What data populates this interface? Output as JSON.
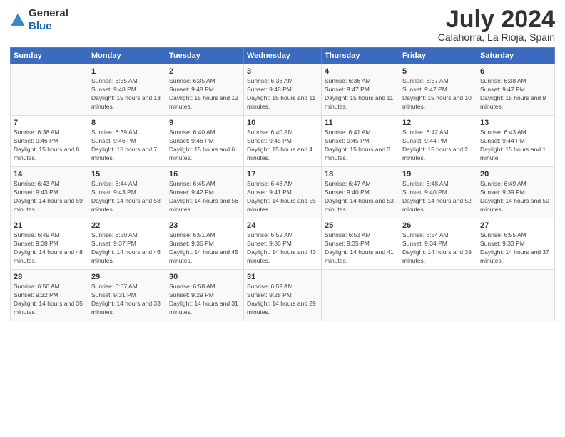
{
  "logo": {
    "general": "General",
    "blue": "Blue"
  },
  "title": "July 2024",
  "location": "Calahorra, La Rioja, Spain",
  "days_header": [
    "Sunday",
    "Monday",
    "Tuesday",
    "Wednesday",
    "Thursday",
    "Friday",
    "Saturday"
  ],
  "weeks": [
    [
      {
        "day": "",
        "sunrise": "",
        "sunset": "",
        "daylight": ""
      },
      {
        "day": "1",
        "sunrise": "Sunrise: 6:35 AM",
        "sunset": "Sunset: 9:48 PM",
        "daylight": "Daylight: 15 hours and 13 minutes."
      },
      {
        "day": "2",
        "sunrise": "Sunrise: 6:35 AM",
        "sunset": "Sunset: 9:48 PM",
        "daylight": "Daylight: 15 hours and 12 minutes."
      },
      {
        "day": "3",
        "sunrise": "Sunrise: 6:36 AM",
        "sunset": "Sunset: 9:48 PM",
        "daylight": "Daylight: 15 hours and 11 minutes."
      },
      {
        "day": "4",
        "sunrise": "Sunrise: 6:36 AM",
        "sunset": "Sunset: 9:47 PM",
        "daylight": "Daylight: 15 hours and 11 minutes."
      },
      {
        "day": "5",
        "sunrise": "Sunrise: 6:37 AM",
        "sunset": "Sunset: 9:47 PM",
        "daylight": "Daylight: 15 hours and 10 minutes."
      },
      {
        "day": "6",
        "sunrise": "Sunrise: 6:38 AM",
        "sunset": "Sunset: 9:47 PM",
        "daylight": "Daylight: 15 hours and 9 minutes."
      }
    ],
    [
      {
        "day": "7",
        "sunrise": "Sunrise: 6:38 AM",
        "sunset": "Sunset: 9:46 PM",
        "daylight": "Daylight: 15 hours and 8 minutes."
      },
      {
        "day": "8",
        "sunrise": "Sunrise: 6:39 AM",
        "sunset": "Sunset: 9:46 PM",
        "daylight": "Daylight: 15 hours and 7 minutes."
      },
      {
        "day": "9",
        "sunrise": "Sunrise: 6:40 AM",
        "sunset": "Sunset: 9:46 PM",
        "daylight": "Daylight: 15 hours and 6 minutes."
      },
      {
        "day": "10",
        "sunrise": "Sunrise: 6:40 AM",
        "sunset": "Sunset: 9:45 PM",
        "daylight": "Daylight: 15 hours and 4 minutes."
      },
      {
        "day": "11",
        "sunrise": "Sunrise: 6:41 AM",
        "sunset": "Sunset: 9:45 PM",
        "daylight": "Daylight: 15 hours and 3 minutes."
      },
      {
        "day": "12",
        "sunrise": "Sunrise: 6:42 AM",
        "sunset": "Sunset: 9:44 PM",
        "daylight": "Daylight: 15 hours and 2 minutes."
      },
      {
        "day": "13",
        "sunrise": "Sunrise: 6:43 AM",
        "sunset": "Sunset: 9:44 PM",
        "daylight": "Daylight: 15 hours and 1 minute."
      }
    ],
    [
      {
        "day": "14",
        "sunrise": "Sunrise: 6:43 AM",
        "sunset": "Sunset: 9:43 PM",
        "daylight": "Daylight: 14 hours and 59 minutes."
      },
      {
        "day": "15",
        "sunrise": "Sunrise: 6:44 AM",
        "sunset": "Sunset: 9:43 PM",
        "daylight": "Daylight: 14 hours and 58 minutes."
      },
      {
        "day": "16",
        "sunrise": "Sunrise: 6:45 AM",
        "sunset": "Sunset: 9:42 PM",
        "daylight": "Daylight: 14 hours and 56 minutes."
      },
      {
        "day": "17",
        "sunrise": "Sunrise: 6:46 AM",
        "sunset": "Sunset: 9:41 PM",
        "daylight": "Daylight: 14 hours and 55 minutes."
      },
      {
        "day": "18",
        "sunrise": "Sunrise: 6:47 AM",
        "sunset": "Sunset: 9:40 PM",
        "daylight": "Daylight: 14 hours and 53 minutes."
      },
      {
        "day": "19",
        "sunrise": "Sunrise: 6:48 AM",
        "sunset": "Sunset: 9:40 PM",
        "daylight": "Daylight: 14 hours and 52 minutes."
      },
      {
        "day": "20",
        "sunrise": "Sunrise: 6:49 AM",
        "sunset": "Sunset: 9:39 PM",
        "daylight": "Daylight: 14 hours and 50 minutes."
      }
    ],
    [
      {
        "day": "21",
        "sunrise": "Sunrise: 6:49 AM",
        "sunset": "Sunset: 9:38 PM",
        "daylight": "Daylight: 14 hours and 48 minutes."
      },
      {
        "day": "22",
        "sunrise": "Sunrise: 6:50 AM",
        "sunset": "Sunset: 9:37 PM",
        "daylight": "Daylight: 14 hours and 46 minutes."
      },
      {
        "day": "23",
        "sunrise": "Sunrise: 6:51 AM",
        "sunset": "Sunset: 9:36 PM",
        "daylight": "Daylight: 14 hours and 45 minutes."
      },
      {
        "day": "24",
        "sunrise": "Sunrise: 6:52 AM",
        "sunset": "Sunset: 9:36 PM",
        "daylight": "Daylight: 14 hours and 43 minutes."
      },
      {
        "day": "25",
        "sunrise": "Sunrise: 6:53 AM",
        "sunset": "Sunset: 9:35 PM",
        "daylight": "Daylight: 14 hours and 41 minutes."
      },
      {
        "day": "26",
        "sunrise": "Sunrise: 6:54 AM",
        "sunset": "Sunset: 9:34 PM",
        "daylight": "Daylight: 14 hours and 39 minutes."
      },
      {
        "day": "27",
        "sunrise": "Sunrise: 6:55 AM",
        "sunset": "Sunset: 9:33 PM",
        "daylight": "Daylight: 14 hours and 37 minutes."
      }
    ],
    [
      {
        "day": "28",
        "sunrise": "Sunrise: 6:56 AM",
        "sunset": "Sunset: 9:32 PM",
        "daylight": "Daylight: 14 hours and 35 minutes."
      },
      {
        "day": "29",
        "sunrise": "Sunrise: 6:57 AM",
        "sunset": "Sunset: 9:31 PM",
        "daylight": "Daylight: 14 hours and 33 minutes."
      },
      {
        "day": "30",
        "sunrise": "Sunrise: 6:58 AM",
        "sunset": "Sunset: 9:29 PM",
        "daylight": "Daylight: 14 hours and 31 minutes."
      },
      {
        "day": "31",
        "sunrise": "Sunrise: 6:59 AM",
        "sunset": "Sunset: 9:28 PM",
        "daylight": "Daylight: 14 hours and 29 minutes."
      },
      {
        "day": "",
        "sunrise": "",
        "sunset": "",
        "daylight": ""
      },
      {
        "day": "",
        "sunrise": "",
        "sunset": "",
        "daylight": ""
      },
      {
        "day": "",
        "sunrise": "",
        "sunset": "",
        "daylight": ""
      }
    ]
  ]
}
